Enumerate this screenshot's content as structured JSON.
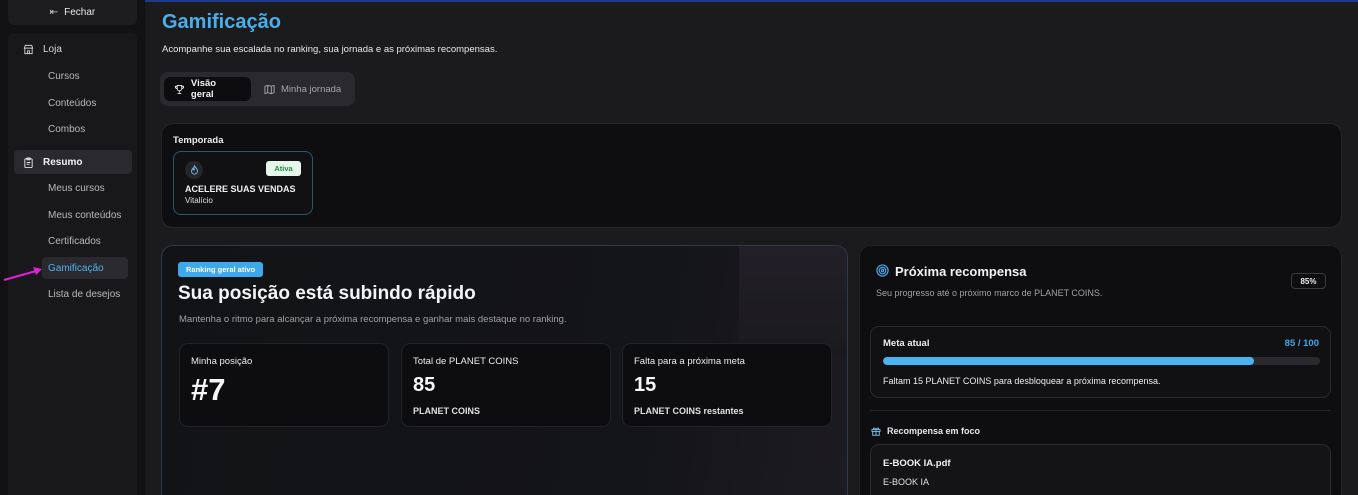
{
  "sidebar": {
    "close_label": "Fechar",
    "groups": [
      {
        "label": "Loja",
        "items": [
          "Cursos",
          "Conteúdos",
          "Combos"
        ]
      },
      {
        "label": "Resumo",
        "items": [
          "Meus cursos",
          "Meus conteúdos",
          "Certificados",
          "Gamificação",
          "Lista de desejos"
        ]
      }
    ],
    "active_item": "Gamificação"
  },
  "page": {
    "title": "Gamificação",
    "subtitle": "Acompanhe sua escalada no ranking, sua jornada e as próximas recompensas."
  },
  "tabs": [
    {
      "label": "Visão geral",
      "icon": "trophy-icon",
      "active": true
    },
    {
      "label": "Minha jornada",
      "icon": "map-icon",
      "active": false
    }
  ],
  "season": {
    "label": "Temporada",
    "item": {
      "name": "ACELERE SUAS VENDAS",
      "duration": "Vitalício",
      "status": "Ativa"
    }
  },
  "ranking": {
    "badge": "Ranking geral ativo",
    "title": "Sua posição está subindo rápido",
    "subtitle": "Mantenha o ritmo para alcançar a próxima recompensa e ganhar mais destaque no ranking.",
    "stats": [
      {
        "label": "Minha posição",
        "value": "#7",
        "unit": ""
      },
      {
        "label": "Total de PLANET COINS",
        "value": "85",
        "unit": "PLANET COINS"
      },
      {
        "label": "Falta para a próxima meta",
        "value": "15",
        "unit": "PLANET COINS restantes"
      }
    ]
  },
  "reward": {
    "title": "Próxima recompensa",
    "percent_label": "85%",
    "subtitle": "Seu progresso até o próximo marco de PLANET COINS.",
    "goal": {
      "label": "Meta atual",
      "value_label": "85 / 100",
      "progress": 0.85,
      "message": "Faltam 15 PLANET COINS para desbloquear a próxima recompensa."
    },
    "focus": {
      "label": "Recompensa em foco",
      "name": "E-BOOK IA.pdf",
      "sub": "E-BOOK IA"
    }
  },
  "colors": {
    "accent": "#49aeea",
    "active_badge": "#1f8c3d",
    "annotation_arrow": "#e020d8"
  }
}
